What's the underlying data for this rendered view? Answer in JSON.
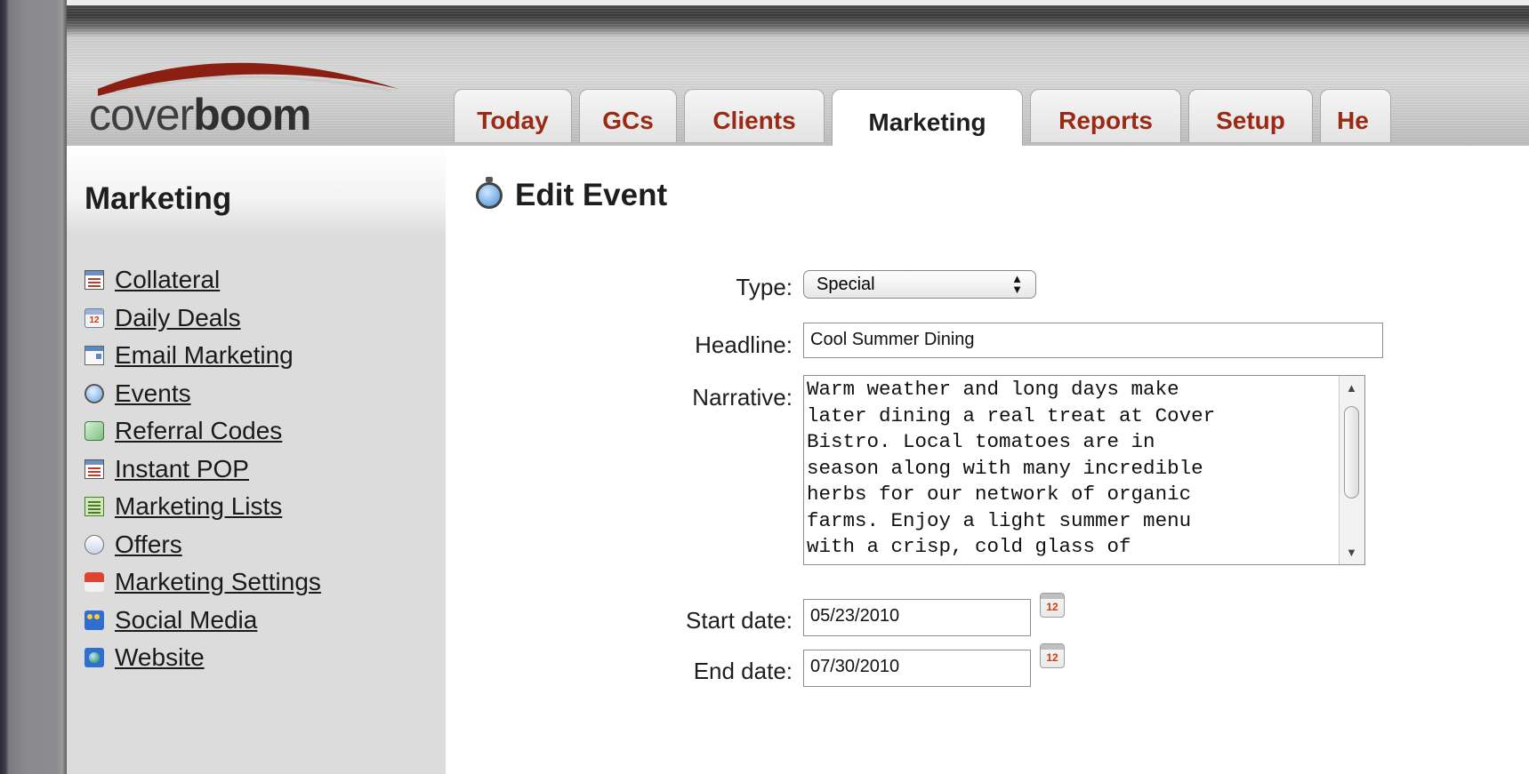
{
  "brand": {
    "logo_light": "cover",
    "logo_bold": "boom"
  },
  "tabs": [
    {
      "label": "Today"
    },
    {
      "label": "GCs"
    },
    {
      "label": "Clients"
    },
    {
      "label": "Marketing",
      "active": true
    },
    {
      "label": "Reports"
    },
    {
      "label": "Setup"
    },
    {
      "label": "He"
    }
  ],
  "sidebar": {
    "title": "Marketing",
    "items": [
      {
        "label": "Collateral",
        "icon": "document-icon"
      },
      {
        "label": "Daily Deals",
        "icon": "calendar-icon"
      },
      {
        "label": "Email Marketing",
        "icon": "email-icon"
      },
      {
        "label": "Events",
        "icon": "stopwatch-icon"
      },
      {
        "label": "Referral Codes",
        "icon": "referral-icon"
      },
      {
        "label": "Instant POP",
        "icon": "document-icon"
      },
      {
        "label": "Marketing Lists",
        "icon": "list-icon"
      },
      {
        "label": "Offers",
        "icon": "offers-icon"
      },
      {
        "label": "Marketing Settings",
        "icon": "settings-icon"
      },
      {
        "label": "Social Media",
        "icon": "people-icon"
      },
      {
        "label": "Website",
        "icon": "globe-icon"
      }
    ]
  },
  "page": {
    "title": "Edit Event"
  },
  "form": {
    "type": {
      "label": "Type:",
      "value": "Special"
    },
    "headline": {
      "label": "Headline:",
      "value": "Cool Summer Dining"
    },
    "narrative": {
      "label": "Narrative:",
      "value": "Warm weather and long days make\nlater dining a real treat at Cover\nBistro. Local tomatoes are in\nseason along with many incredible\nherbs for our network of organic\nfarms. Enjoy a light summer menu\nwith a crisp, cold glass of"
    },
    "start_date": {
      "label": "Start date:",
      "value": "05/23/2010"
    },
    "end_date": {
      "label": "End date:",
      "value": "07/30/2010"
    },
    "calendar_day": "12"
  },
  "colors": {
    "tab_text": "#9b2a14",
    "active_tab_text": "#1f1f1f",
    "sidebar_bg": "#dcdcdc"
  }
}
